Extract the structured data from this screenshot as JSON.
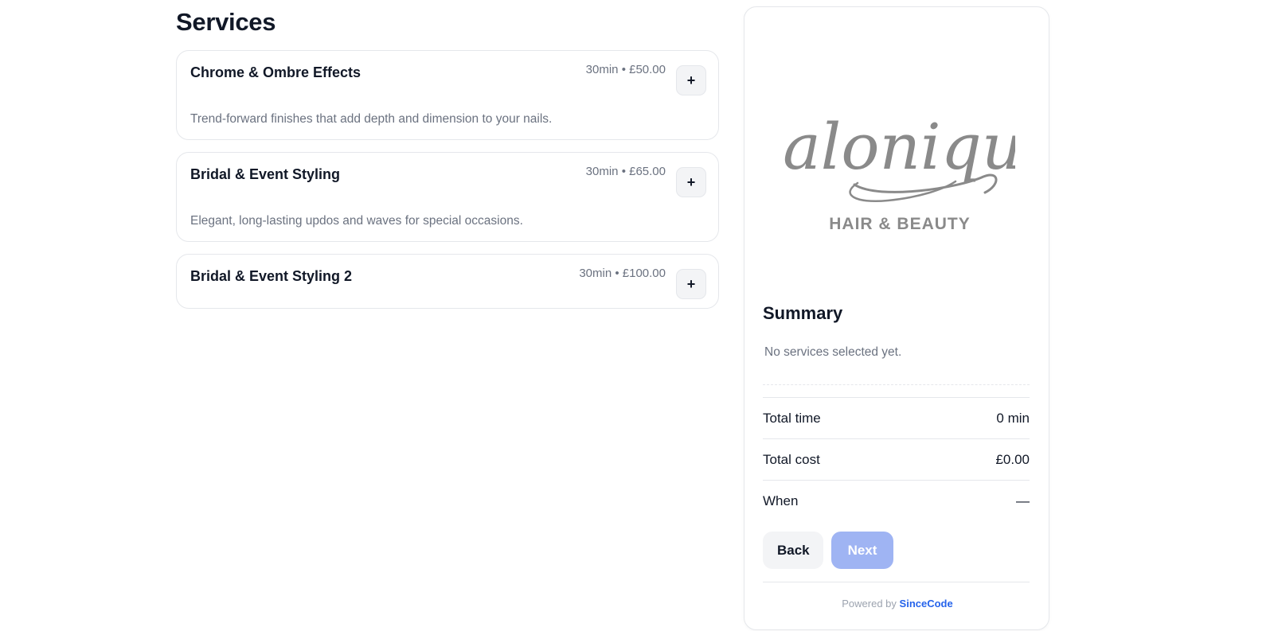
{
  "services": {
    "title": "Services",
    "items": [
      {
        "name": "Chrome & Ombre Effects",
        "meta": "30min • £50.00",
        "description": "Trend-forward finishes that add depth and dimension to your nails.",
        "add_label": "+"
      },
      {
        "name": "Bridal & Event Styling",
        "meta": "30min • £65.00",
        "description": "Elegant, long-lasting updos and waves for special occasions.",
        "add_label": "+"
      },
      {
        "name": "Bridal & Event Styling 2",
        "meta": "30min • £100.00",
        "description": "",
        "add_label": "+"
      }
    ]
  },
  "panel": {
    "logo": {
      "script": "Salonique",
      "subtitle": "HAIR & BEAUTY",
      "color": "#8a8a8a"
    },
    "summary_title": "Summary",
    "empty_text": "No services selected yet.",
    "rows": [
      {
        "label": "Total time",
        "value": "0 min"
      },
      {
        "label": "Total cost",
        "value": "£0.00"
      },
      {
        "label": "When",
        "value": "—"
      }
    ],
    "back_label": "Back",
    "next_label": "Next",
    "footer_prefix": "Powered by",
    "footer_link": "SinceCode"
  },
  "colors": {
    "accent_link": "#2563eb",
    "next_disabled": "#9fb4f3",
    "border": "#e5e7eb"
  }
}
